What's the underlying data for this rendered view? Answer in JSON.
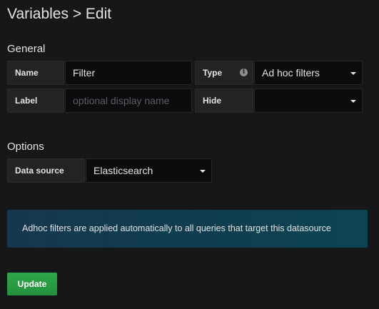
{
  "header": {
    "title": "Variables > Edit"
  },
  "general": {
    "section_title": "General",
    "name": {
      "label": "Name",
      "value": "Filter"
    },
    "type": {
      "label": "Type",
      "info_icon": "info-icon",
      "selected": "Ad hoc filters"
    },
    "label": {
      "label": "Label",
      "value": "",
      "placeholder": "optional display name"
    },
    "hide": {
      "label": "Hide",
      "selected": ""
    }
  },
  "options": {
    "section_title": "Options",
    "data_source": {
      "label": "Data source",
      "selected": "Elasticsearch"
    }
  },
  "info_banner": {
    "text": "Adhoc filters are applied automatically to all queries that target this datasource"
  },
  "actions": {
    "update_label": "Update",
    "accent_color": "#299c46"
  }
}
